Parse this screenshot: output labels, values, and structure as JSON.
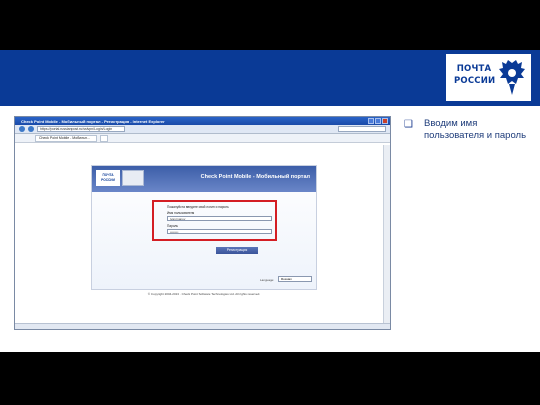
{
  "slide": {
    "logo_text": "ПОЧТА РОССИИ",
    "logo_line1": "ПОЧТА",
    "logo_line2": "РОССИИ",
    "bullet_symbol": "❑",
    "caption": "Вводим имя пользователя и пароль"
  },
  "browser": {
    "title": "Check Point Mobile - Мобильный портал - Регистрация - Internet Explorer",
    "url": "https://portal.russianpost.ru/sslvpn/Login/Login",
    "tab_title": "Check Point Mobile - Мобильн..."
  },
  "portal": {
    "logo_line1": "ПОЧТА",
    "logo_line2": "РОССИИ",
    "title": "Check Point Mobile - Мобильный портал",
    "form_heading": "Пожалуйста введите свой логин и пароль",
    "username_label": "Имя пользователя",
    "username_value": "Ivan.Ivanov",
    "password_label": "Пароль",
    "password_value": "••••••••",
    "register_button": "Регистрация",
    "language_label": "Language:",
    "language_value": "Russian",
    "copyright": "© Copyright 2004-2013 · Check Point Software Technologies Ltd. All rights reserved."
  },
  "colors": {
    "brand_blue": "#0a3a96",
    "highlight_red": "#d41e24"
  }
}
